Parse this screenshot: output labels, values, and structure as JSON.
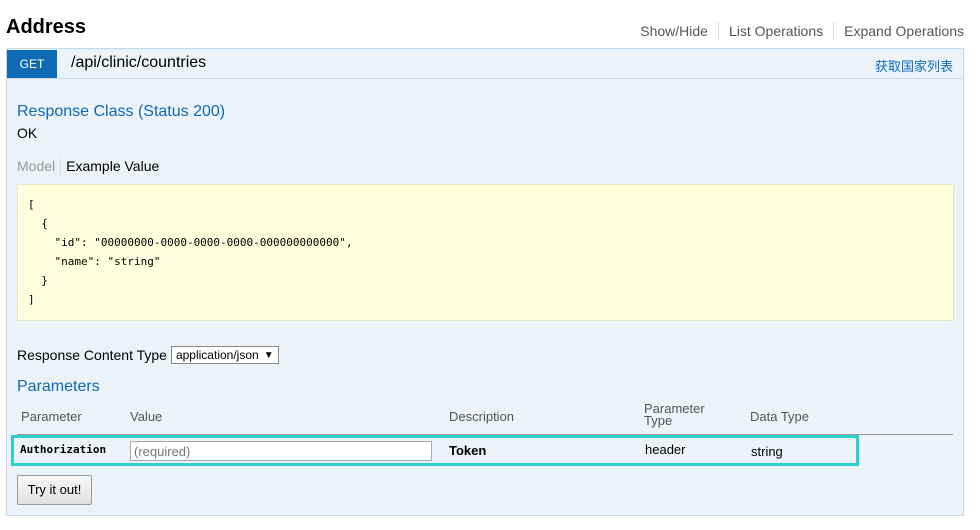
{
  "header": {
    "title": "Address",
    "links": [
      "Show/Hide",
      "List Operations",
      "Expand Operations"
    ]
  },
  "operation": {
    "method": "GET",
    "path": "/api/clinic/countries",
    "summary": "获取国家列表",
    "response_class_title": "Response Class (Status 200)",
    "response_status_text": "OK",
    "model_tab": "Model",
    "example_tab": "Example Value",
    "example_value": "[\n  {\n    \"id\": \"00000000-0000-0000-0000-000000000000\",\n    \"name\": \"string\"\n  }\n]",
    "response_content_type_label": "Response Content Type",
    "response_content_type_value": "application/json",
    "parameters_title": "Parameters",
    "param_headers": {
      "parameter": "Parameter",
      "value": "Value",
      "description": "Description",
      "parameter_type_line1": "Parameter",
      "parameter_type_line2": "Type",
      "data_type": "Data Type"
    },
    "parameters": [
      {
        "name": "Authorization",
        "placeholder": "(required)",
        "description": "Token",
        "parameter_type": "header",
        "data_type": "string"
      }
    ],
    "try_button": "Try it out!"
  }
}
